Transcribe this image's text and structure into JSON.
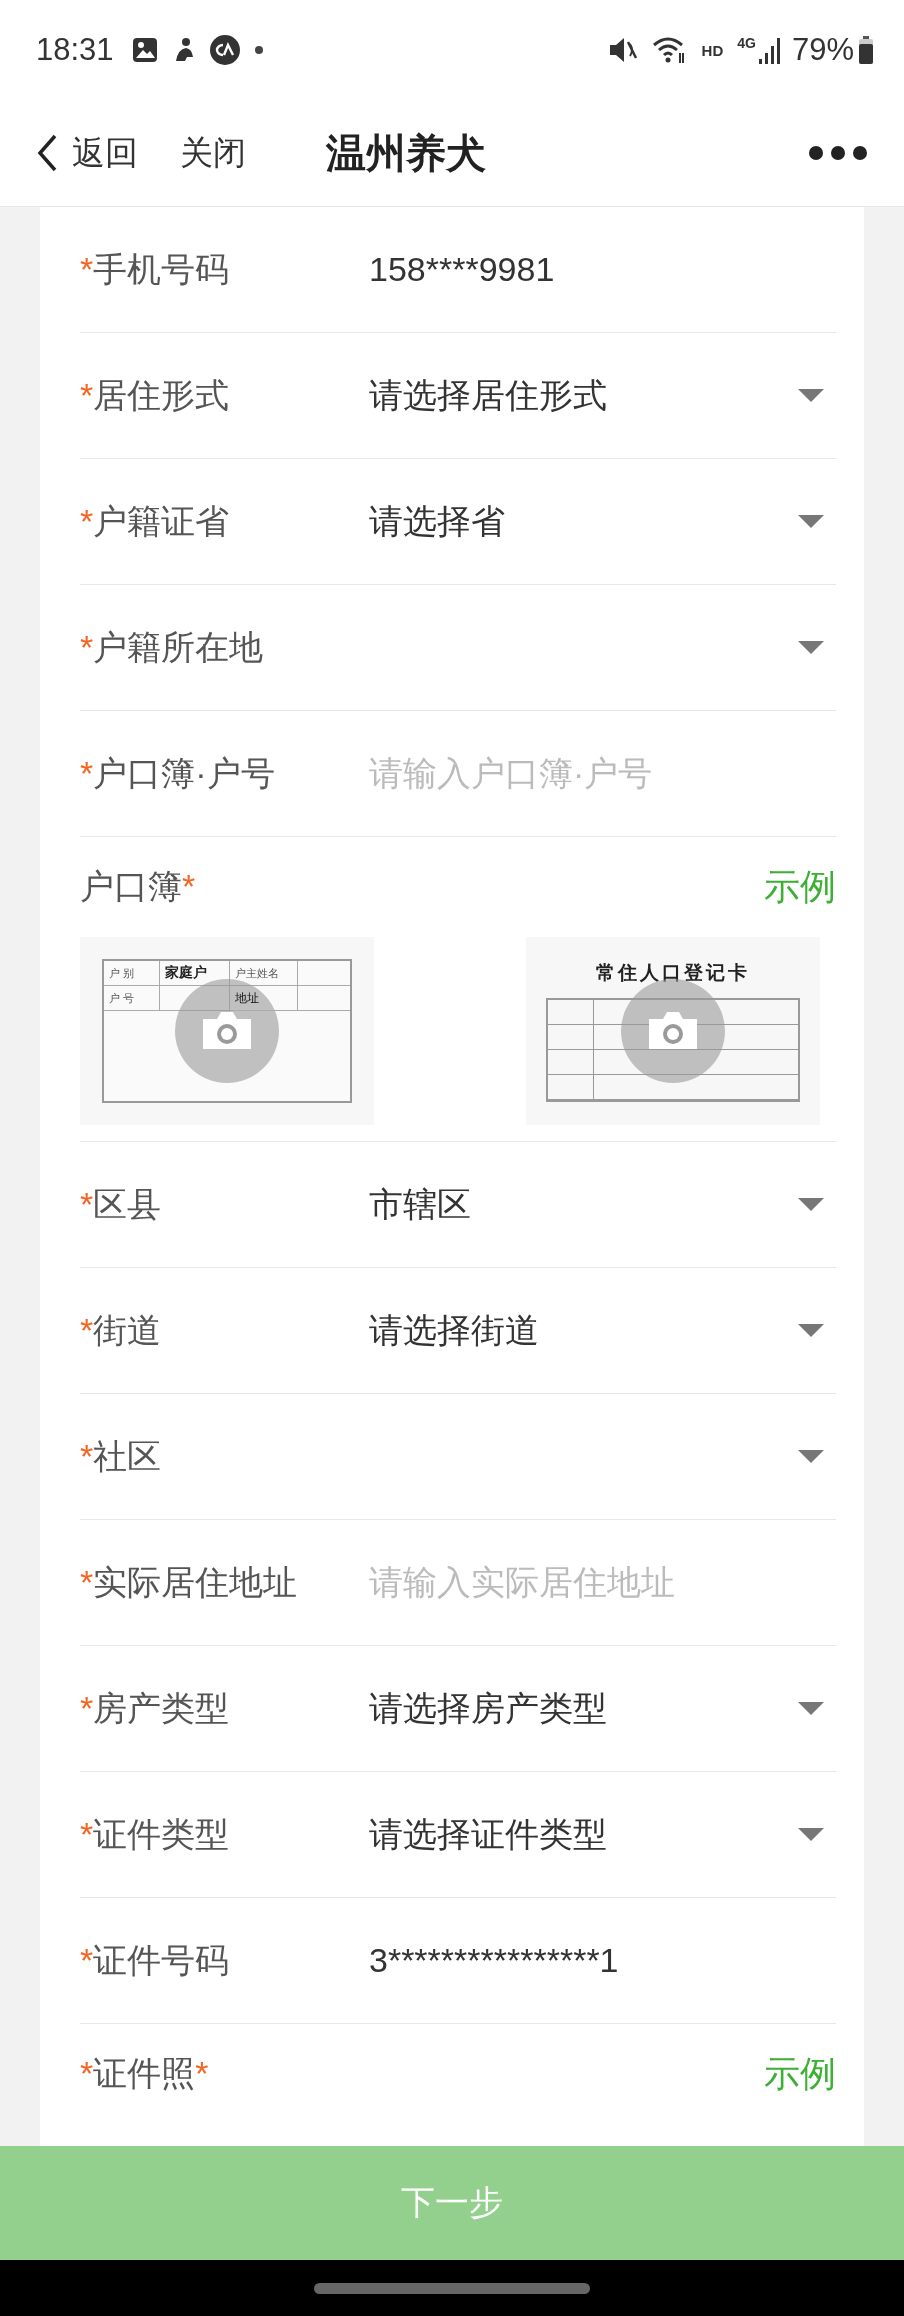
{
  "status_bar": {
    "time": "18:31",
    "hd": "HD",
    "network": "4G",
    "battery": "79%"
  },
  "header": {
    "back": "返回",
    "close": "关闭",
    "title": "温州养犬"
  },
  "fields": [
    {
      "kind": "text",
      "prefix": "*",
      "label": "手机号码",
      "value": "158****9981"
    },
    {
      "kind": "select",
      "prefix": "*",
      "label": "居住形式",
      "value": "请选择居住形式"
    },
    {
      "kind": "select",
      "prefix": "*",
      "label": "户籍证省",
      "value": "请选择省"
    },
    {
      "kind": "select",
      "prefix": "*",
      "label": "户籍所在地"
    },
    {
      "kind": "input",
      "prefix": "*",
      "label": "户口簿·户号",
      "placeholder": "请输入户口簿·户号"
    },
    {
      "kind": "upload",
      "label": "户口簿",
      "suffix": "*",
      "example": "示例",
      "samples": [
        {
          "kind": "household_page",
          "cells": [
            "户 别",
            "家庭户",
            "户主姓名",
            "户 号",
            "地址"
          ]
        },
        {
          "kind": "register_card",
          "title": "常住人口登记卡"
        }
      ]
    },
    {
      "kind": "select",
      "prefix": "*",
      "label": "区县",
      "value": "市辖区"
    },
    {
      "kind": "select",
      "prefix": "*",
      "label": "街道",
      "value": "请选择街道"
    },
    {
      "kind": "select",
      "prefix": "*",
      "label": "社区"
    },
    {
      "kind": "input",
      "prefix": "*",
      "label": "实际居住地址",
      "placeholder": "请输入实际居住地址"
    },
    {
      "kind": "select",
      "prefix": "*",
      "label": "房产类型",
      "value": "请选择房产类型"
    },
    {
      "kind": "select",
      "prefix": "*",
      "label": "证件类型",
      "value": "请选择证件类型"
    },
    {
      "kind": "text",
      "prefix": "*",
      "label": "证件号码",
      "value": "3****************1"
    },
    {
      "kind": "upload",
      "prefix": "*",
      "label": "证件照",
      "suffix": "*",
      "example": "示例"
    }
  ],
  "next_button": {
    "label": "下一步",
    "disabled": true
  }
}
